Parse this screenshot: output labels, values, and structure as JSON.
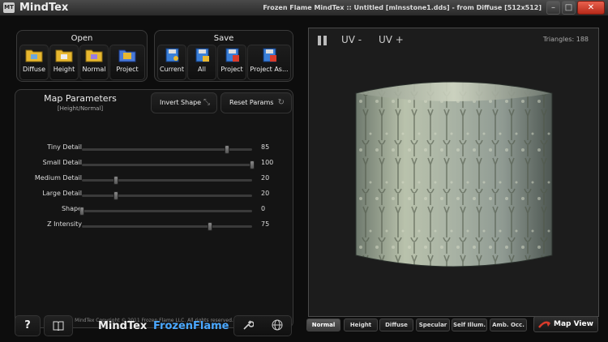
{
  "window": {
    "icon_text": "MT",
    "app_title": "MindTex",
    "doc_title": "Frozen Flame MindTex :: Untitled [mlnsstone1.dds] - from Diffuse [512x512]",
    "minimize": "–",
    "maximize": "□",
    "close": "✕"
  },
  "open_group": {
    "title": "Open",
    "buttons": [
      {
        "label": "Diffuse",
        "icon": "folder-icon"
      },
      {
        "label": "Height",
        "icon": "folder-icon"
      },
      {
        "label": "Normal",
        "icon": "folder-icon"
      },
      {
        "label": "Project",
        "icon": "folder-icon"
      }
    ]
  },
  "save_group": {
    "title": "Save",
    "buttons": [
      {
        "label": "Current",
        "icon": "floppy-icon"
      },
      {
        "label": "All",
        "icon": "floppy-icon"
      },
      {
        "label": "Project",
        "icon": "floppy-icon"
      },
      {
        "label": "Project As...",
        "icon": "floppy-icon"
      }
    ]
  },
  "map_params": {
    "title": "Map Parameters",
    "subtitle": "[Height/Normal]",
    "invert_label": "Invert Shape",
    "reset_label": "Reset Params",
    "params": [
      {
        "label": "Tiny Detail",
        "value": "85",
        "fraction": 0.85
      },
      {
        "label": "Small Detail",
        "value": "100",
        "fraction": 1.0
      },
      {
        "label": "Medium Detail",
        "value": "20",
        "fraction": 0.2
      },
      {
        "label": "Large Detail",
        "value": "20",
        "fraction": 0.2
      },
      {
        "label": "Shape",
        "value": "0",
        "fraction": 0.0
      },
      {
        "label": "Z Intensity",
        "value": "75",
        "fraction": 0.75
      }
    ],
    "copyright": "MindTex Copyright © 2011 Frozen Flame LLC. All rights reserved."
  },
  "bottom": {
    "help": "?",
    "brand_mindtex": "MindTex",
    "brand_frozen": "FrozenFlame"
  },
  "viewport": {
    "uv_minus": "UV -",
    "uv_plus": "UV +",
    "triangles": "Triangles: 188"
  },
  "map_tabs": [
    "Normal",
    "Height",
    "Diffuse",
    "Specular",
    "Self Illum.",
    "Amb. Occ."
  ],
  "map_view_label": "Map View",
  "colors": {
    "folder": "#e8b830",
    "floppy": "#3a7fd8",
    "brand_frozen": "#4aa8ff",
    "accent_red": "#d93b2b"
  }
}
